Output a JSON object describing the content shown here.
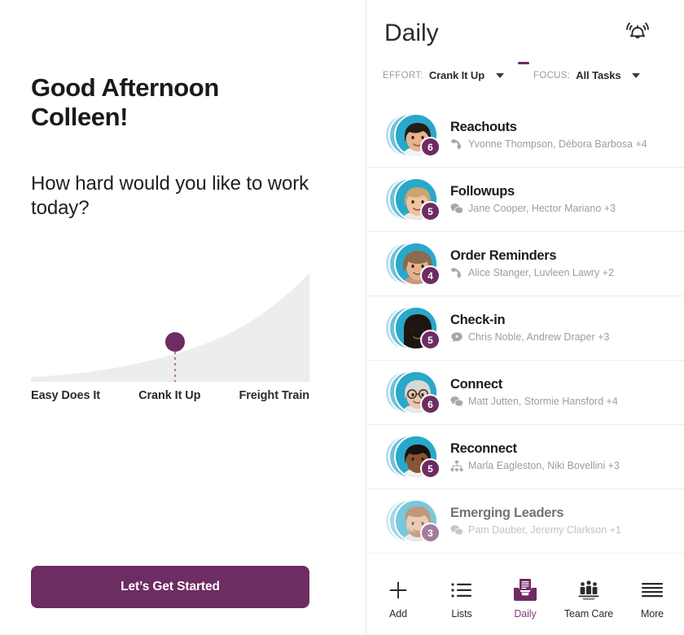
{
  "theme": {
    "purple": "#6d2c62",
    "purple_light": "#8a3a7c",
    "teal": "#29a8c9",
    "grey_text": "#9d9d9d",
    "curve_fill": "#ededed"
  },
  "left": {
    "greeting_line1": "Good Afternoon",
    "greeting_line2": "Colleen!",
    "prompt": "How hard would you like to work today?",
    "effort_labels": [
      "Easy Does It",
      "Crank It Up",
      "Freight Train"
    ],
    "selected_effort": "Crank It Up",
    "start_button_label": "Let’s Get Started"
  },
  "chart_data": {
    "type": "area",
    "title": "",
    "xlabel": "",
    "ylabel": "",
    "categories": [
      "Easy Does It",
      "Crank It Up",
      "Freight Train"
    ],
    "x": [
      0,
      0.5,
      1
    ],
    "values": [
      0.04,
      0.28,
      1.0
    ],
    "ylim": [
      0,
      1
    ],
    "xlim": [
      0,
      1
    ],
    "grid": false,
    "legend": "none",
    "selected_index": 1,
    "marker_x": 0.5,
    "marker_y": 0.28,
    "annotations": [
      "knob at Crank It Up"
    ]
  },
  "right": {
    "header": {
      "title": "Daily",
      "bell_icon": "bell-ringing-icon"
    },
    "filters": [
      {
        "label": "EFFORT:",
        "value": "Crank It Up",
        "name": "effort"
      },
      {
        "label": "FOCUS:",
        "value": "All Tasks",
        "name": "focus"
      }
    ],
    "tasks": [
      {
        "title": "Reachouts",
        "names": "Yvonne Thompson, Débora Barbosa +4",
        "count": "6",
        "icon": "phone-receiver-icon",
        "faded": false
      },
      {
        "title": "Followups",
        "names": "Jane Cooper, Hector Mariano +3",
        "count": "5",
        "icon": "speech-bubbles-icon",
        "faded": false
      },
      {
        "title": "Order Reminders",
        "names": "Alice Stanger, Luvleen Lawry +2",
        "count": "4",
        "icon": "phone-receiver-icon",
        "faded": false
      },
      {
        "title": "Check-in",
        "names": "Chris Noble, Andrew Draper +3",
        "count": "5",
        "icon": "speech-bubble-icon",
        "faded": false
      },
      {
        "title": "Connect",
        "names": "Matt Jutten, Stormie Hansford +4",
        "count": "6",
        "icon": "speech-bubbles-icon",
        "faded": false
      },
      {
        "title": "Reconnect",
        "names": "Marla Eagleston, Niki Bovellini +3",
        "count": "5",
        "icon": "sitemap-icon",
        "faded": false
      },
      {
        "title": "Emerging Leaders",
        "names": "Pam Dauber, Jeremy Clarkson +1",
        "count": "3",
        "icon": "speech-bubbles-icon",
        "faded": true
      }
    ],
    "nav": [
      {
        "label": "Add",
        "icon": "plus-icon",
        "active": false
      },
      {
        "label": "Lists",
        "icon": "list-icon",
        "active": false
      },
      {
        "label": "Daily",
        "icon": "inbox-tray-icon",
        "active": true
      },
      {
        "label": "Team Care",
        "icon": "people-group-icon",
        "active": false
      },
      {
        "label": "More",
        "icon": "hamburger-icon",
        "active": false
      }
    ]
  }
}
